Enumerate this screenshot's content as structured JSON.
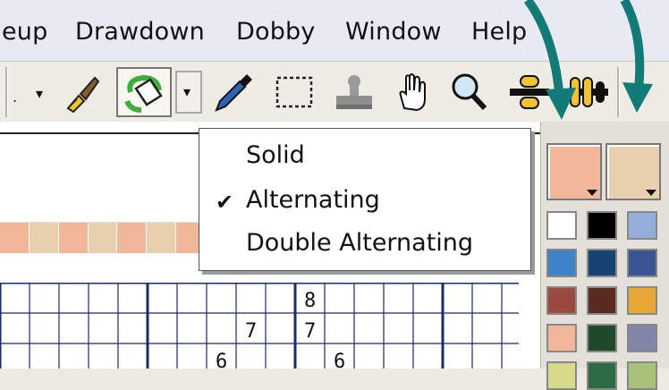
{
  "menubar": {
    "items": [
      {
        "label": "eup"
      },
      {
        "label": "Drawdown"
      },
      {
        "label": "Dobby"
      },
      {
        "label": "Window"
      },
      {
        "label": "Help"
      }
    ]
  },
  "toolbar": {
    "dropdown_glyph": "▾",
    "icons": [
      "paintbrush-icon",
      "fill-alternate-icon",
      "eyedropper-icon",
      "marquee-select-icon",
      "stamp-icon",
      "hand-icon",
      "magnifier-icon",
      "repeat-icon",
      "double-repeat-icon"
    ]
  },
  "fill_menu": {
    "items": [
      {
        "label": "Solid",
        "checked": false
      },
      {
        "label": "Alternating",
        "checked": true
      },
      {
        "label": "Double Alternating",
        "checked": false
      }
    ],
    "check_glyph": "✔"
  },
  "color_strip": {
    "colors": [
      "#f1b79b",
      "#e8d0ae",
      "#f1b79b",
      "#e8d0ae",
      "#f1b79b",
      "#e8d0ae",
      "#f1b79b"
    ]
  },
  "grid": {
    "numbers": [
      {
        "text": "8"
      },
      {
        "text": "7"
      },
      {
        "text": "7"
      },
      {
        "text": "6"
      },
      {
        "text": "6"
      }
    ]
  },
  "palette": {
    "primary_color": "#f1b79b",
    "secondary_color": "#e8d0ae",
    "swatches": [
      "#ffffff",
      "#000000",
      "#93aed6",
      "#3f82c8",
      "#174373",
      "#3a5591",
      "#9c4a3f",
      "#5b2a1e",
      "#e9a835",
      "#f1b79b",
      "#1f4a2a",
      "#8284a8",
      "#d9d98a",
      "#2e6b45",
      "#a9c27a"
    ]
  },
  "accent_colors": {
    "arrow": "#127b77",
    "grid_line": "#1d2a6e"
  }
}
